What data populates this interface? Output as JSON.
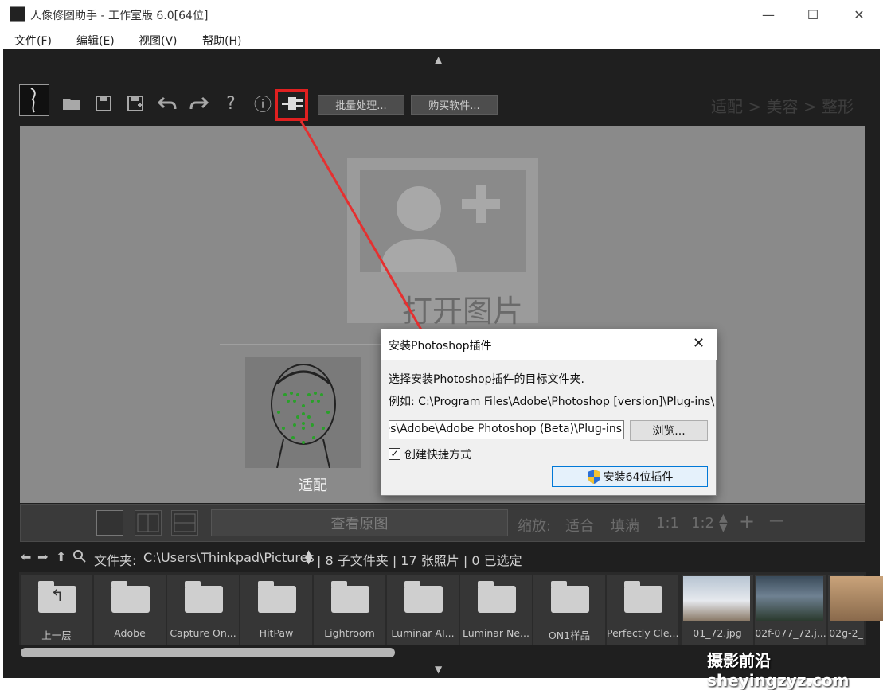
{
  "window": {
    "title": "人像修图助手 - 工作室版 6.0[64位]",
    "minimize": "—",
    "maximize": "☐",
    "close": "✕"
  },
  "menu": [
    "文件(F)",
    "编辑(E)",
    "视图(V)",
    "帮助(H)"
  ],
  "toolbar": {
    "batch_label": "批量处理...",
    "buy_label": "购买软件...",
    "help_glyph": "?",
    "info_glyph": "ⓘ",
    "steps": "适配 > 美容 > 整形"
  },
  "canvas": {
    "open_image_text": "打开图片",
    "fit_label": "适配"
  },
  "controls": {
    "view_original": "查看原图",
    "zoom_label": "缩放:",
    "zoom_fit": "适合",
    "zoom_fill": "填满",
    "zoom_1_1": "1:1",
    "zoom_1_2": "1:2",
    "zoom_in": "+",
    "zoom_out": "—"
  },
  "path": {
    "label": "文件夹:",
    "path": "C:\\Users\\Thinkpad\\Pictures",
    "stats": "| 8 子文件夹 | 17 张照片 | 0 已选定"
  },
  "thumbnails": [
    {
      "label": "上一层",
      "kind": "up"
    },
    {
      "label": "Adobe",
      "kind": "folder"
    },
    {
      "label": "Capture On...",
      "kind": "folder"
    },
    {
      "label": "HitPaw",
      "kind": "folder"
    },
    {
      "label": "Lightroom",
      "kind": "folder"
    },
    {
      "label": "Luminar AI...",
      "kind": "folder"
    },
    {
      "label": "Luminar Ne...",
      "kind": "folder"
    },
    {
      "label": "ON1样品",
      "kind": "folder"
    },
    {
      "label": "Perfectly Cle...",
      "kind": "folder"
    },
    {
      "label": "01_72.jpg",
      "kind": "photo"
    },
    {
      "label": "02f-077_72.j...",
      "kind": "photo"
    },
    {
      "label": "02g-2_",
      "kind": "photo"
    }
  ],
  "dialog": {
    "title": "安装Photoshop插件",
    "description": "选择安装Photoshop插件的目标文件夹.",
    "example": "例如: C:\\Program Files\\Adobe\\Photoshop [version]\\Plug-ins\\",
    "path_value": "es\\Adobe\\Adobe Photoshop (Beta)\\Plug-ins",
    "browse_label": "浏览...",
    "shortcut_label": "创建快捷方式",
    "shortcut_checked": true,
    "install_label": "安装64位插件"
  },
  "watermark": "摄影前沿 sheyingzyz.com",
  "colors": {
    "highlight": "#e02020",
    "dialog_accent": "#0078d7"
  }
}
